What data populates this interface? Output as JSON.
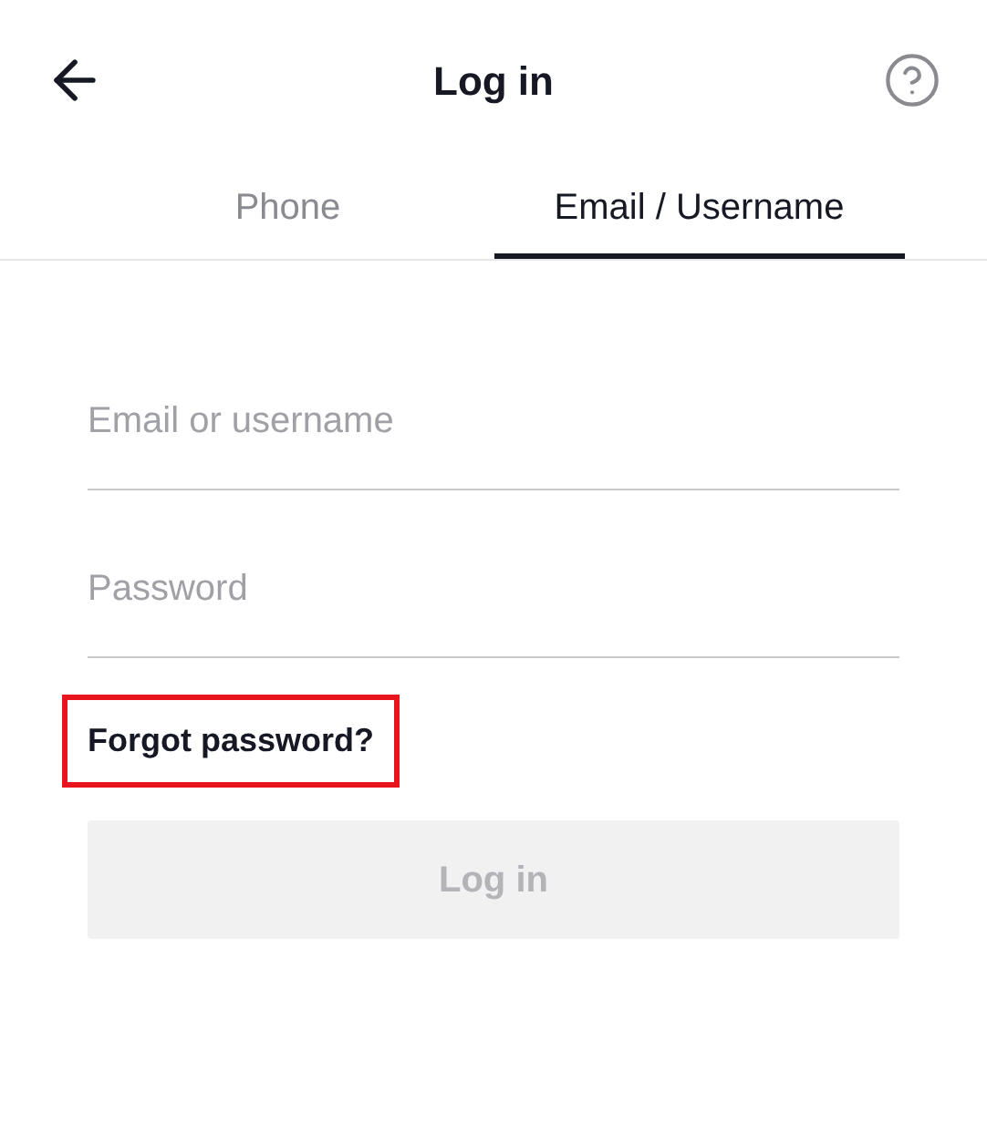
{
  "header": {
    "title": "Log in"
  },
  "tabs": [
    {
      "label": "Phone",
      "selected": false
    },
    {
      "label": "Email / Username",
      "selected": true
    }
  ],
  "fields": [
    {
      "placeholder": "Email or username"
    },
    {
      "placeholder": "Password"
    }
  ],
  "forgot_link": {
    "label": "Forgot password?",
    "highlighted": true
  },
  "login_button": {
    "label": "Log in",
    "disabled": true
  }
}
